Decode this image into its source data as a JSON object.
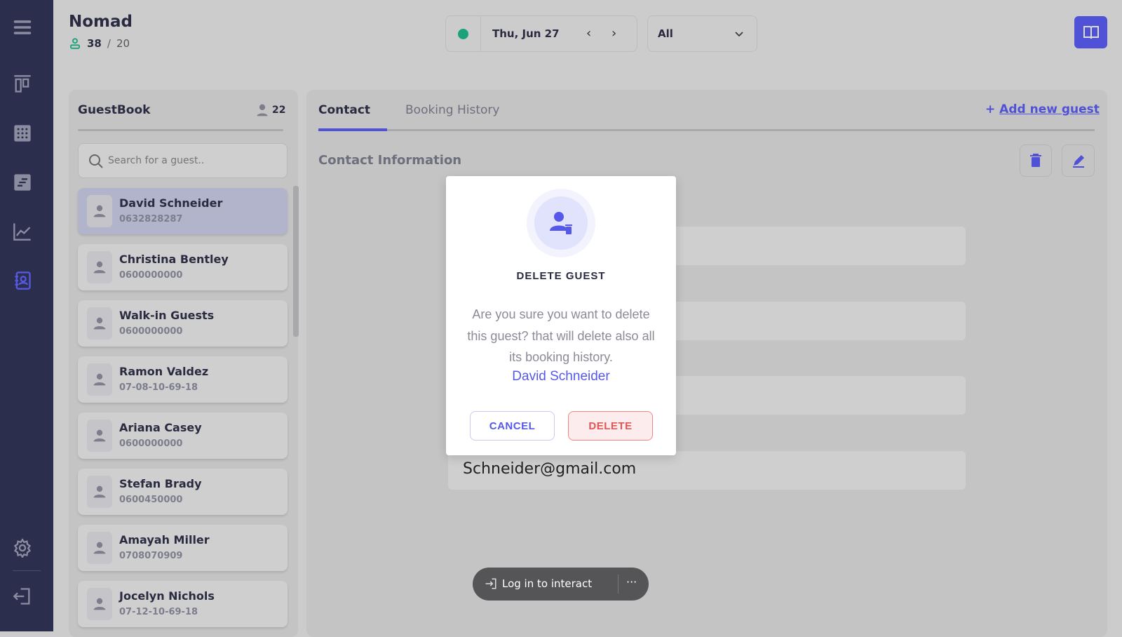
{
  "app": {
    "title": "Nomad",
    "occupancy_current": "38",
    "occupancy_sep": "/",
    "occupancy_total": "20"
  },
  "toolbar": {
    "date": "Thu, Jun 27",
    "filter": "All",
    "status_color": "#1aa37a"
  },
  "guestbook": {
    "title": "GuestBook",
    "count": "22",
    "search_placeholder": "Search for a guest..",
    "guests": [
      {
        "name": "David Schneider",
        "phone": "0632828287"
      },
      {
        "name": "Christina Bentley",
        "phone": "0600000000"
      },
      {
        "name": "Walk-in Guests",
        "phone": "0600000000"
      },
      {
        "name": "Ramon Valdez",
        "phone": "07-08-10-69-18"
      },
      {
        "name": "Ariana Casey",
        "phone": "0600000000"
      },
      {
        "name": "Stefan Brady",
        "phone": "0600450000"
      },
      {
        "name": "Amayah Miller",
        "phone": "0708070909"
      },
      {
        "name": "Jocelyn Nichols",
        "phone": "07-12-10-69-18"
      }
    ]
  },
  "main": {
    "tabs": [
      {
        "label": "Contact"
      },
      {
        "label": "Booking History"
      }
    ],
    "add_label": "Add new guest",
    "section_title": "Contact Information",
    "email": "Schneider@gmail.com"
  },
  "modal": {
    "title": "DELETE GUEST",
    "message": "Are you sure you want to delete this guest? that will delete also all its booking history.",
    "guest_name": "David Schneider",
    "cancel": "CANCEL",
    "delete": "DELETE"
  },
  "login": {
    "label": "Log in to interact"
  },
  "colors": {
    "accent": "#4f52d6",
    "sidebar": "#2c2e4e",
    "danger": "#e05555"
  }
}
